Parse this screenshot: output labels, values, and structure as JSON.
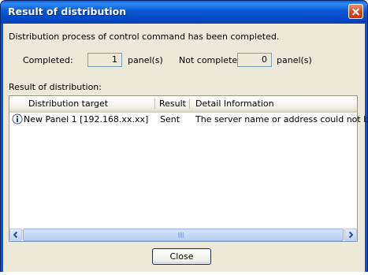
{
  "window": {
    "title": "Result of distribution"
  },
  "message": "Distribution process of control command has been completed.",
  "summary": {
    "completed_label": "Completed:",
    "completed_value": "1",
    "completed_unit": "panel(s)",
    "not_completed_label": "Not completed:",
    "not_completed_value": "0",
    "not_completed_unit": "panel(s)"
  },
  "results": {
    "section_label": "Result of distribution:",
    "columns": [
      "Distribution target",
      "Result",
      "Detail Information"
    ],
    "rows": [
      {
        "icon": "info-icon",
        "target": "New Panel 1 [192.168.xx.xx]",
        "result": "Sent",
        "detail": "The server name or address could not be"
      }
    ]
  },
  "buttons": {
    "close_label": "Close"
  },
  "colors": {
    "titlebar": "#0a58d3",
    "dialog_bg": "#ece9d8",
    "close_x": "#d6471a",
    "field_border": "#7f9db9"
  }
}
